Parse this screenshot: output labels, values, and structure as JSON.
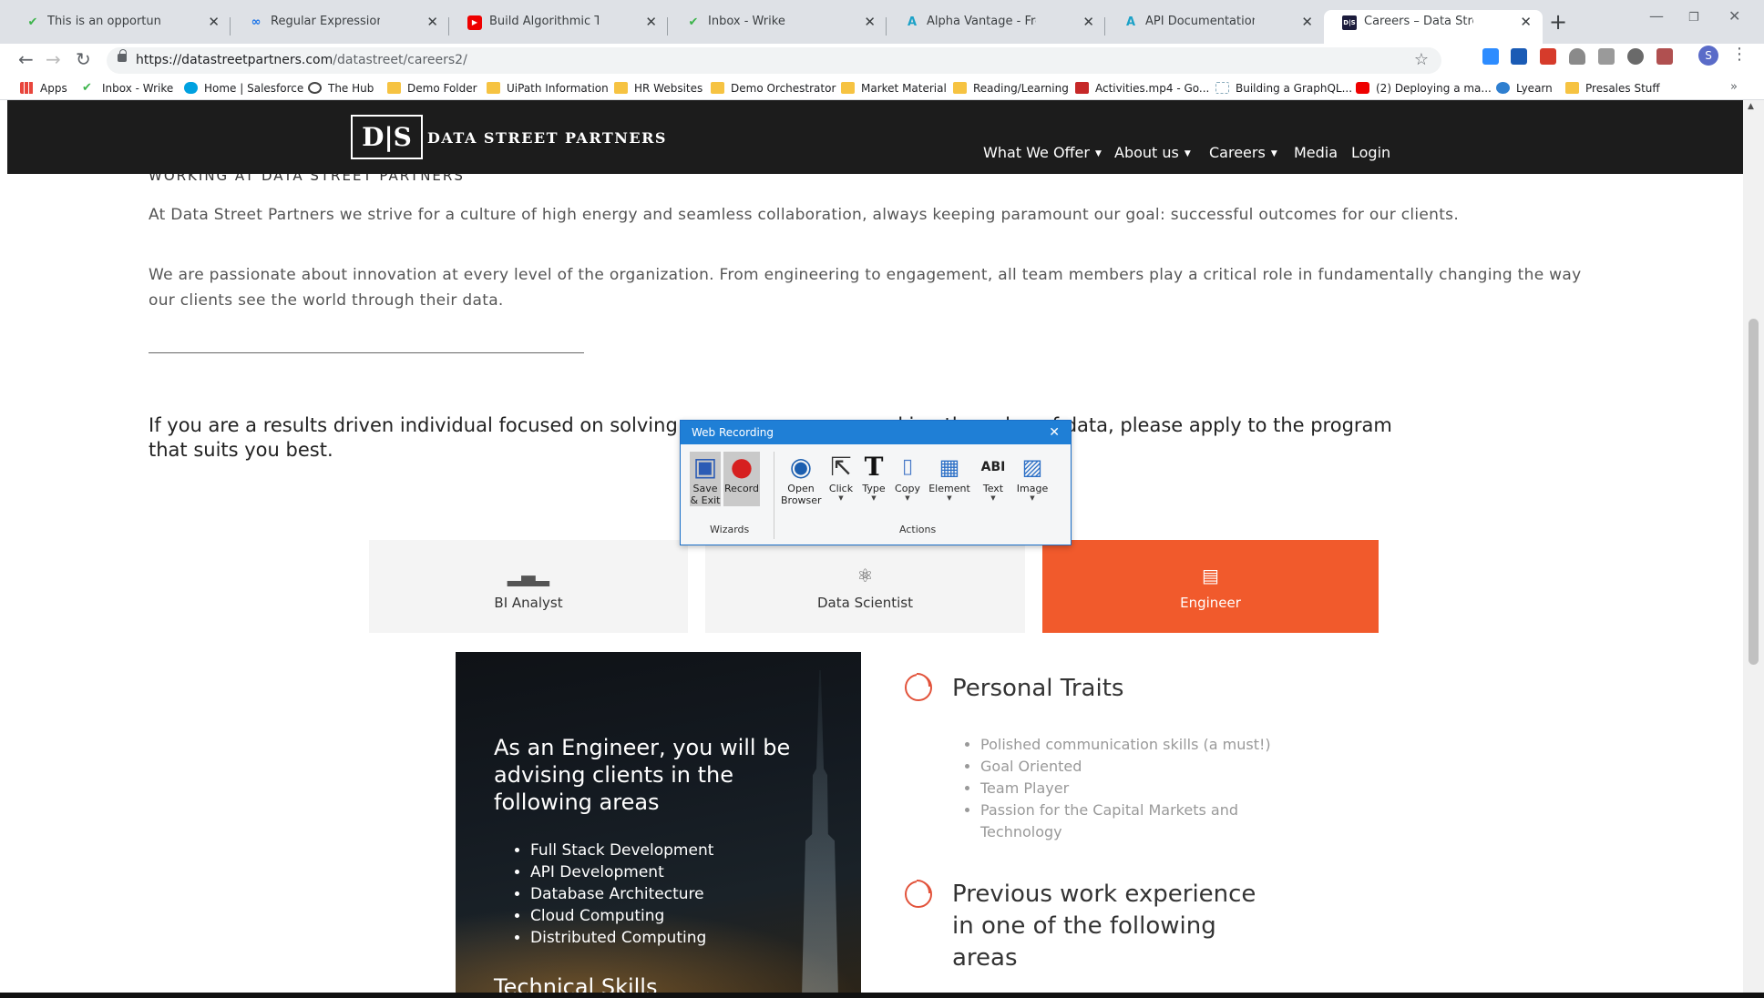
{
  "browser": {
    "tabs": [
      {
        "label": "This is an opportunity - Wrike",
        "icon": "wrike-icon"
      },
      {
        "label": "Regular Expressions - University",
        "icon": "link-icon"
      },
      {
        "label": "Build Algorithmic Trading Strateg",
        "icon": "youtube-icon"
      },
      {
        "label": "Inbox - Wrike",
        "icon": "wrike-icon"
      },
      {
        "label": "Alpha Vantage - Free APIs for Re",
        "icon": "alphavantage-icon"
      },
      {
        "label": "API Documentation | Alpha Vanta",
        "icon": "alphavantage-icon"
      },
      {
        "label": "Careers – Data Street Partners",
        "icon": "ds-icon",
        "active": true
      }
    ],
    "url_host": "https://datastreetpartners.com",
    "url_path": "/datastreet/careers2/",
    "bookmarks": [
      {
        "label": "Apps",
        "icon": "apps-grid-icon"
      },
      {
        "label": "Inbox - Wrike",
        "icon": "wrike-icon"
      },
      {
        "label": "Home | Salesforce",
        "icon": "salesforce-icon"
      },
      {
        "label": "The Hub",
        "icon": "globe-icon"
      },
      {
        "label": "Demo Folder",
        "icon": "folder-icon"
      },
      {
        "label": "UiPath Information",
        "icon": "folder-icon"
      },
      {
        "label": "HR Websites",
        "icon": "folder-icon"
      },
      {
        "label": "Demo Orchestrator",
        "icon": "folder-icon"
      },
      {
        "label": "Market Material",
        "icon": "folder-icon"
      },
      {
        "label": "Reading/Learning",
        "icon": "folder-icon"
      },
      {
        "label": "Activities.mp4 - Go...",
        "icon": "video-icon"
      },
      {
        "label": "Building a GraphQL...",
        "icon": "graphql-icon"
      },
      {
        "label": "(2) Deploying a ma...",
        "icon": "youtube-icon"
      },
      {
        "label": "Lyearn",
        "icon": "lyearn-icon"
      },
      {
        "label": "Presales Stuff",
        "icon": "folder-icon"
      }
    ],
    "avatar_letter": "S"
  },
  "site": {
    "logo_mark": "D|S",
    "logo_text": "DATA STREET PARTNERS",
    "nav": [
      {
        "label": "What We Offer",
        "dropdown": true
      },
      {
        "label": "About us",
        "dropdown": true
      },
      {
        "label": "Careers",
        "dropdown": true
      },
      {
        "label": "Media",
        "dropdown": false
      },
      {
        "label": "Login",
        "dropdown": false
      }
    ],
    "kicker": "WORKING AT DATA STREET PARTNERS",
    "para1": "At Data Street Partners we strive for a culture of high energy and seamless collaboration, always keeping paramount our goal: successful outcomes for our clients.",
    "para2": "We are passionate about innovation at every level of the organization. From engineering to engagement, all team members play a critical role in fundamentally changing the way our clients see the world through their data.",
    "lead_part1": "If you are a results driven individual focused on solving",
    "lead_part2": "cking the value of data, please apply to the program",
    "lead_part3": "that suits you best.",
    "roles": [
      {
        "label": "BI Analyst",
        "icon": "bar-chart-icon"
      },
      {
        "label": "Data Scientist",
        "icon": "atom-icon"
      },
      {
        "label": "Engineer",
        "icon": "document-icon",
        "active": true
      }
    ],
    "engineer": {
      "heading": "As an Engineer, you will be advising clients in the following areas",
      "areas": [
        "Full Stack Development",
        "API Development",
        "Database Architecture",
        "Cloud Computing",
        "Distributed Computing"
      ],
      "tech_title": "Technical Skills"
    },
    "traits_title": "Personal Traits",
    "traits": [
      "Polished communication skills (a must!)",
      "Goal Oriented",
      "Team Player",
      "Passion for the Capital Markets and Technology"
    ],
    "experience_title": "Previous work experience in one of the following areas"
  },
  "recorder": {
    "title": "Web Recording",
    "wizards_group": "Wizards",
    "actions_group": "Actions",
    "buttons": [
      {
        "label": "Save & Exit",
        "icon": "floppy-disk-icon"
      },
      {
        "label": "Record",
        "icon": "record-icon"
      },
      {
        "label": "Open Browser",
        "icon": "globe-icon"
      },
      {
        "label": "Click",
        "icon": "cursor-icon"
      },
      {
        "label": "Type",
        "icon": "type-icon"
      },
      {
        "label": "Copy",
        "icon": "copy-icon"
      },
      {
        "label": "Element",
        "icon": "element-icon"
      },
      {
        "label": "Text",
        "icon": "text-icon"
      },
      {
        "label": "Image",
        "icon": "image-icon"
      }
    ]
  }
}
